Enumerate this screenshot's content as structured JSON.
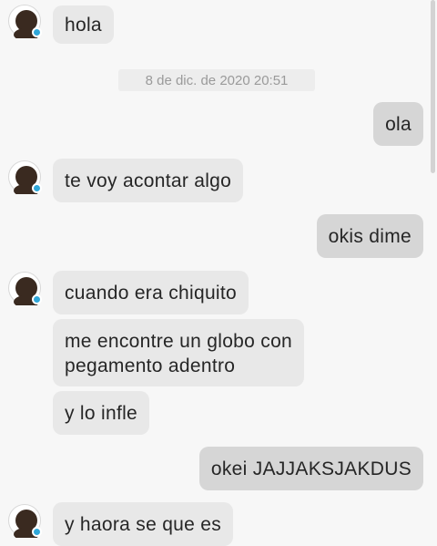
{
  "timestamp": "8 de dic. de 2020 20:51",
  "messages": [
    {
      "side": "in",
      "text": "hola"
    },
    {
      "side": "out",
      "text": "ola"
    },
    {
      "side": "in",
      "text": "te voy acontar algo"
    },
    {
      "side": "out",
      "text": "okis dime"
    },
    {
      "side": "in",
      "text": "cuando era chiquito"
    },
    {
      "side": "in",
      "lines": [
        "me encontre un globo con",
        "pegamento adentro"
      ]
    },
    {
      "side": "in",
      "text": "y lo infle"
    },
    {
      "side": "out",
      "text": "okei JAJJAKSJAKDUS"
    },
    {
      "side": "in",
      "text": "y haora se que es"
    }
  ],
  "colors": {
    "background": "#f7f7f7",
    "incoming_bubble": "#e8e8e8",
    "outgoing_bubble": "#d6d6d6",
    "status_dot": "#2fa7d9"
  },
  "icons": {
    "avatar": "user-avatar-icon",
    "online_status": "online-status-dot-icon"
  }
}
